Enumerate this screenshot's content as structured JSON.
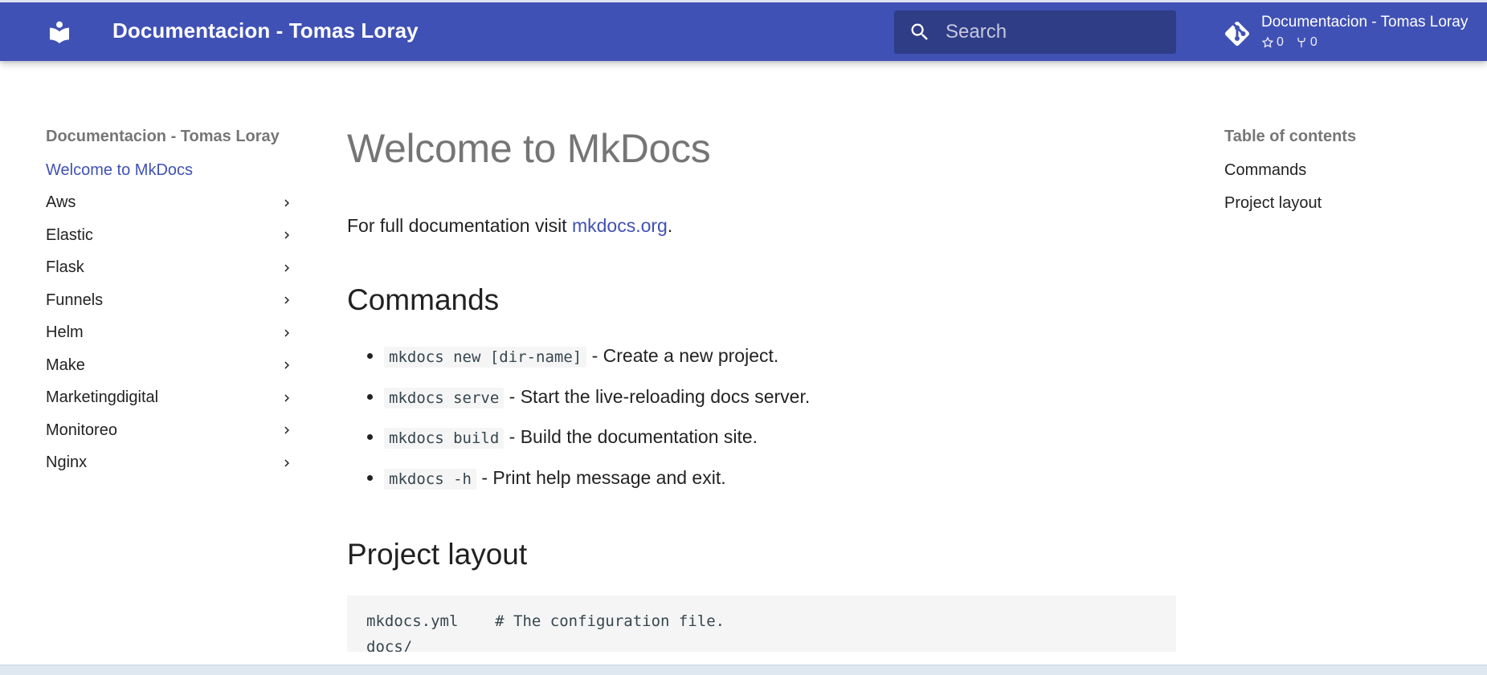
{
  "header": {
    "site_title": "Documentacion - Tomas Loray",
    "search_placeholder": "Search",
    "repo": {
      "name": "Documentacion - Tomas Loray",
      "stars": "0",
      "forks": "0"
    },
    "colors": {
      "primary": "#4051b5"
    }
  },
  "nav": {
    "title": "Documentacion - Tomas Loray",
    "items": [
      {
        "label": "Welcome to MkDocs",
        "active": true,
        "expandable": false
      },
      {
        "label": "Aws",
        "expandable": true
      },
      {
        "label": "Elastic",
        "expandable": true
      },
      {
        "label": "Flask",
        "expandable": true
      },
      {
        "label": "Funnels",
        "expandable": true
      },
      {
        "label": "Helm",
        "expandable": true
      },
      {
        "label": "Make",
        "expandable": true
      },
      {
        "label": "Marketingdigital",
        "expandable": true
      },
      {
        "label": "Monitoreo",
        "expandable": true
      },
      {
        "label": "Nginx",
        "expandable": true
      }
    ]
  },
  "content": {
    "title": "Welcome to MkDocs",
    "intro_prefix": "For full documentation visit ",
    "intro_link": "mkdocs.org",
    "intro_suffix": ".",
    "commands_heading": "Commands",
    "commands": [
      {
        "code": "mkdocs new [dir-name]",
        "desc": " - Create a new project."
      },
      {
        "code": "mkdocs serve",
        "desc": " - Start the live-reloading docs server."
      },
      {
        "code": "mkdocs build",
        "desc": " - Build the documentation site."
      },
      {
        "code": "mkdocs -h",
        "desc": " - Print help message and exit."
      }
    ],
    "layout_heading": "Project layout",
    "layout_lines": [
      "mkdocs.yml    # The configuration file.",
      "docs/"
    ]
  },
  "toc": {
    "title": "Table of contents",
    "items": [
      "Commands",
      "Project layout"
    ]
  }
}
